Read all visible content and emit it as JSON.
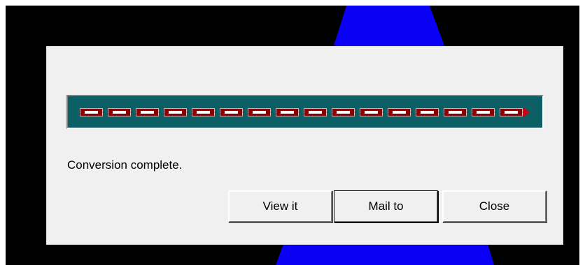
{
  "progress": {
    "value_percent": 100,
    "segment_count": 16,
    "track_color": "#0b5f65",
    "segment_color": "#8a0006",
    "arrow_color": "#d00010"
  },
  "status": {
    "message": "Conversion complete."
  },
  "buttons": {
    "view_label": "View it",
    "mail_label": "Mail to",
    "close_label": "Close"
  },
  "colors": {
    "background_desktop": "#000000",
    "accent_beam": "#0a00f5",
    "dialog_background": "#f0f0f0"
  }
}
